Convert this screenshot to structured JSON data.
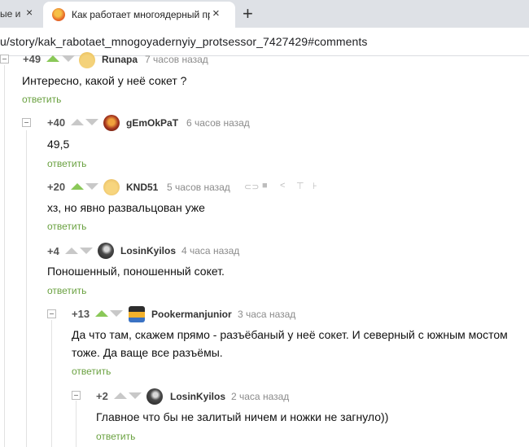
{
  "browser": {
    "prev_tab_label": "ые и",
    "prev_tab_close": "×",
    "active_tab_title": "Как работает многоядерный пр",
    "active_tab_close": "×",
    "new_tab": "+",
    "url": "u/story/kak_rabotaet_mnogoyadernyiy_protsessor_7427429#comments"
  },
  "comments": [
    {
      "rating": "+49",
      "upvoted": true,
      "user": "Runapa",
      "time": "7 часов назад",
      "text": [
        "Интересно, какой у неё сокет ?"
      ],
      "reply": "ответить",
      "avatar": "runapa-avatar"
    },
    {
      "rating": "+40",
      "upvoted": false,
      "user": "gEmOkPaT",
      "time": "6 часов назад",
      "text": [
        "49,5"
      ],
      "reply": "ответить",
      "avatar": "gem-avatar"
    },
    {
      "rating": "+20",
      "upvoted": true,
      "user": "KND51",
      "time": "5 часов назад",
      "text": [
        "хз, но явно развальцован уже"
      ],
      "reply": "ответить",
      "avatar": "knd-avatar",
      "tools": [
        "link-icon",
        "save-icon",
        "share-icon",
        "pin-icon",
        "more-icon"
      ]
    },
    {
      "rating": "+4",
      "upvoted": false,
      "user": "LosinKyilos",
      "time": "4 часа назад",
      "text": [
        "Поношенный, поношенный сокет."
      ],
      "reply": "ответить",
      "avatar": "losin-avatar"
    },
    {
      "rating": "+13",
      "upvoted": true,
      "user": "Pookermanjunior",
      "time": "3 часа назад",
      "text": [
        "Да что там, скажем прямо - разъёбаный у неё сокет. И северный с южным мостом",
        "тоже. Да ваще все разъёмы."
      ],
      "reply": "ответить",
      "avatar": "pooker-avatar"
    },
    {
      "rating": "+2",
      "upvoted": false,
      "user": "LosinKyilos",
      "time": "2 часа назад",
      "text": [
        "Главное что бы не залитый ничем и ножки не загнуло))"
      ],
      "reply": "ответить",
      "avatar": "losin-avatar"
    }
  ],
  "colors": {
    "upvote": "#8ac858",
    "reply": "#6aa140",
    "arrow_inactive": "#c8c8c8"
  }
}
